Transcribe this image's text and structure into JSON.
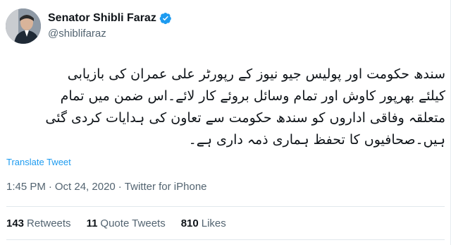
{
  "author": {
    "name": "Senator Shibli Faraz",
    "handle": "@shiblifaraz"
  },
  "tweet": {
    "lines": [
      "سندھ حکومت اور پولیس جیو نیوز کے رپورٹر علی عمران کی بازیابی",
      "کیلئے بھرپور کاوش اور تمام وسائل بروئے کار لائے۔اس ضمن میں تمام",
      "متعلقہ وفاقی اداروں کو سندھ حکومت سے تعاون کی ہدایات کردی گئی",
      "ہیں۔صحافیوں کا تحفظ ہماری ذمہ داری ہے۔"
    ],
    "translate_label": "Translate Tweet"
  },
  "meta": {
    "time": "1:45 PM",
    "separator1": "·",
    "date": "Oct 24, 2020",
    "separator2": "·",
    "source": "Twitter for iPhone"
  },
  "stats": {
    "retweets_count": "143",
    "retweets_label": "Retweets",
    "quotes_count": "11",
    "quotes_label": "Quote Tweets",
    "likes_count": "810",
    "likes_label": "Likes"
  },
  "colors": {
    "accent": "#1d9bf0",
    "text": "#0f1419",
    "muted": "#536471"
  },
  "icons": {
    "verified": "verified-badge-icon",
    "avatar": "profile-photo"
  }
}
